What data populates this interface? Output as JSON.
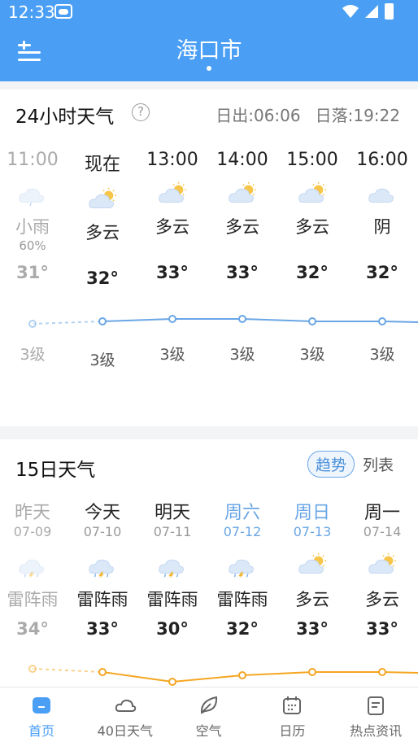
{
  "status_bar": {
    "time": "12:33"
  },
  "header": {
    "city": "海口市"
  },
  "hourly": {
    "title": "24小时天气",
    "help": "?",
    "sunrise": "日出:06:06",
    "sunset": "日落:19:22",
    "items": [
      {
        "time": "11:00",
        "icon": "light-rain-icon",
        "condition": "小雨",
        "precip": "60%",
        "temp": "31°",
        "wind": "3级",
        "temp_value": 31,
        "past": true
      },
      {
        "time": "现在",
        "icon": "partly-cloudy-icon",
        "condition": "多云",
        "precip": "",
        "temp": "32°",
        "wind": "3级",
        "temp_value": 32,
        "past": false
      },
      {
        "time": "13:00",
        "icon": "partly-cloudy-icon",
        "condition": "多云",
        "precip": "",
        "temp": "33°",
        "wind": "3级",
        "temp_value": 33,
        "past": false
      },
      {
        "time": "14:00",
        "icon": "partly-cloudy-icon",
        "condition": "多云",
        "precip": "",
        "temp": "33°",
        "wind": "3级",
        "temp_value": 33,
        "past": false
      },
      {
        "time": "15:00",
        "icon": "partly-cloudy-icon",
        "condition": "多云",
        "precip": "",
        "temp": "32°",
        "wind": "3级",
        "temp_value": 32,
        "past": false
      },
      {
        "time": "16:00",
        "icon": "overcast-icon",
        "condition": "阴",
        "precip": "",
        "temp": "32°",
        "wind": "3级",
        "temp_value": 32,
        "past": false
      }
    ]
  },
  "daily": {
    "title": "15日天气",
    "toggle_active": "趋势",
    "toggle_inactive": "列表",
    "items": [
      {
        "day": "昨天",
        "date": "07-09",
        "icon": "thunderstorm-icon",
        "condition": "雷阵雨",
        "temp": "34°",
        "temp_value": 34,
        "style": "muted"
      },
      {
        "day": "今天",
        "date": "07-10",
        "icon": "thunderstorm-icon",
        "condition": "雷阵雨",
        "temp": "33°",
        "temp_value": 33,
        "style": "normal"
      },
      {
        "day": "明天",
        "date": "07-11",
        "icon": "thunderstorm-icon",
        "condition": "雷阵雨",
        "temp": "30°",
        "temp_value": 30,
        "style": "normal"
      },
      {
        "day": "周六",
        "date": "07-12",
        "icon": "thunderstorm-icon",
        "condition": "雷阵雨",
        "temp": "32°",
        "temp_value": 32,
        "style": "weekend"
      },
      {
        "day": "周日",
        "date": "07-13",
        "icon": "partly-cloudy-icon",
        "condition": "多云",
        "temp": "33°",
        "temp_value": 33,
        "style": "weekend"
      },
      {
        "day": "周一",
        "date": "07-14",
        "icon": "partly-cloudy-icon",
        "condition": "多云",
        "temp": "33°",
        "temp_value": 33,
        "style": "normal"
      }
    ]
  },
  "bottom_nav": [
    {
      "label": "首页",
      "icon": "home-icon",
      "active": true
    },
    {
      "label": "40日天气",
      "icon": "cloud-icon",
      "active": false
    },
    {
      "label": "空气",
      "icon": "leaf-icon",
      "active": false
    },
    {
      "label": "日历",
      "icon": "calendar-icon",
      "active": false
    },
    {
      "label": "热点资讯",
      "icon": "news-icon",
      "active": false
    }
  ],
  "colors": {
    "primary": "#4a9ff5",
    "hourly_line": "#6aa6e6",
    "daily_line": "#f5a623",
    "weekend_text": "#6aa6e6"
  }
}
